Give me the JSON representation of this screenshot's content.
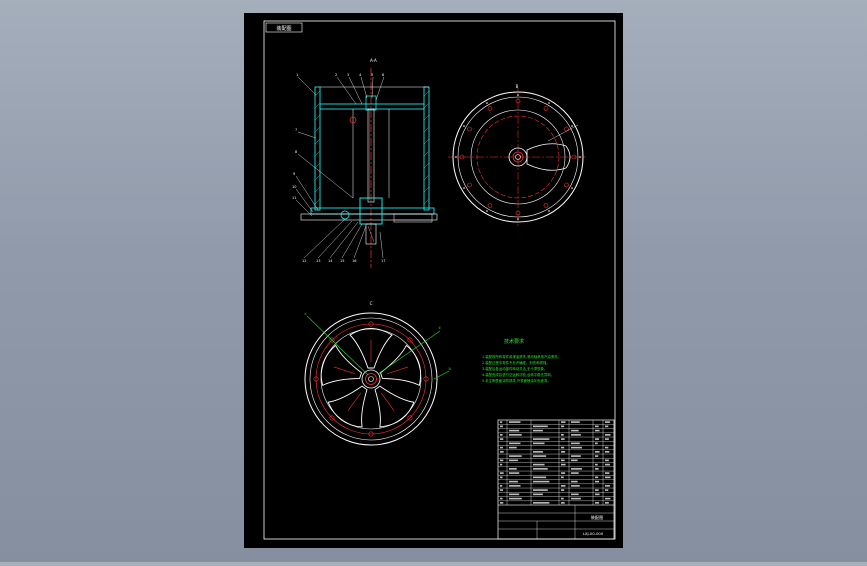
{
  "viewport": {
    "background_top": "#a5aebb",
    "background_bottom": "#858f9f"
  },
  "sheet": {
    "background": "#000000",
    "frame_color": "#ffffff",
    "label": "装配图"
  },
  "colors": {
    "outline": "#ffffff",
    "centerline": "#ff3030",
    "section": "#18e6e6",
    "leader": "#22dd22",
    "label": "#ffffff",
    "annotation": "#22ee22",
    "hole": "#ff3030"
  },
  "views": {
    "section": {
      "label": "A-A"
    },
    "top": {
      "label": "B"
    },
    "bottom": {
      "label": "C"
    }
  },
  "notes": {
    "title": "技术要求",
    "lines": [
      "1.装配前所有零件用煤油清洗,滚动轴承用汽油清洗。",
      "2.装配过程中零件不允许磕碰、划伤和锈蚀。",
      "3.装配后各运动部件转动灵活,无卡滞现象。",
      "4.装配完成后进行空运转试验,运转平稳无异响。",
      "5.未注明表面涂防锈漆,外表面喷涂灰色面漆。"
    ]
  },
  "title_block": {
    "drawing_title": "装配图",
    "drawing_number": "LXJ-00-000"
  }
}
